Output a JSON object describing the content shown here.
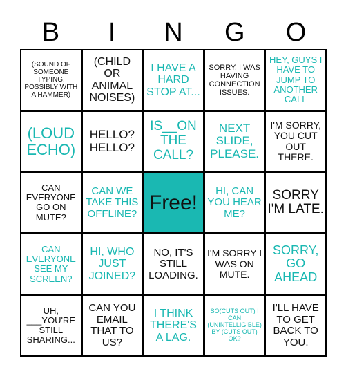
{
  "header": {
    "letters": [
      "B",
      "I",
      "N",
      "G",
      "O"
    ]
  },
  "colors": {
    "accent": "#1ab8b2",
    "text": "#111111",
    "grid": "#000000"
  },
  "board": {
    "cells": [
      [
        "(SOUND OF SOMEONE TYPING, POSSIBLY WITH A HAMMER)",
        "(CHILD OR ANIMAL NOISES)",
        "I HAVE A HARD STOP AT...",
        "SORRY, I WAS HAVING CONNECTION ISSUES.",
        "HEY, GUYS I HAVE TO JUMP TO ANOTHER CALL"
      ],
      [
        "(LOUD ECHO)",
        "HELLO? HELLO?",
        "IS__ON THE CALL?",
        "NEXT SLIDE, PLEASE.",
        "I'M SORRY, YOU CUT OUT THERE."
      ],
      [
        "CAN EVERYONE GO ON MUTE?",
        "CAN WE TAKE THIS OFFLINE?",
        "Free!",
        "HI, CAN YOU HEAR ME?",
        "SORRY I'M LATE."
      ],
      [
        "CAN EVERYONE SEE MY SCREEN?",
        "HI, WHO JUST JOINED?",
        "NO, IT'S STILL LOADING.",
        "I'M SORRY I WAS ON MUTE.",
        "SORRY, GO AHEAD"
      ],
      [
        "UH, ___YOU'RE STILL SHARING...",
        "CAN YOU EMAIL THAT TO US?",
        "I THINK THERE'S A LAG.",
        "SO(CUTS OUT) I CAN (UNINTELLIGIBLE) BY (CUTS OUT) OK?",
        "I'LL HAVE TO GET BACK TO YOU."
      ]
    ]
  }
}
